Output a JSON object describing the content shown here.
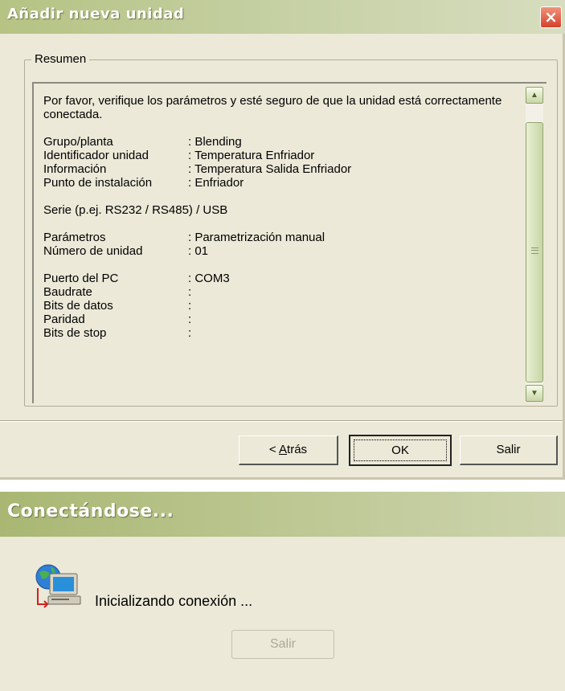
{
  "dialog1": {
    "title": "Añadir nueva unidad",
    "close_label": "×",
    "group_label": "Resumen",
    "intro": "Por favor, verifique los parámetros y esté seguro de que la unidad está correctamente conectada.",
    "rows_a": [
      {
        "key": "Grupo/planta",
        "value": ": Blending"
      },
      {
        "key": "Identificador unidad",
        "value": ": Temperatura Enfriador"
      },
      {
        "key": "Información",
        "value": ": Temperatura Salida Enfriador"
      },
      {
        "key": "Punto de instalación",
        "value": ": Enfriador"
      }
    ],
    "serial_line": "Serie (p.ej. RS232 / RS485) / USB",
    "rows_b": [
      {
        "key": "Parámetros",
        "value": ": Parametrización manual"
      },
      {
        "key": "Número de unidad",
        "value": ": 01"
      }
    ],
    "rows_c": [
      {
        "key": "Puerto del PC",
        "value": ": COM3"
      },
      {
        "key": "Baudrate",
        "value": ":"
      },
      {
        "key": "Bits de datos",
        "value": ":"
      },
      {
        "key": "Paridad",
        "value": ":"
      },
      {
        "key": "Bits de stop",
        "value": ":"
      }
    ],
    "buttons": {
      "back_prefix": "< ",
      "back_mnemonic": "A",
      "back_rest": "trás",
      "ok": "OK",
      "exit": "Salir"
    },
    "scroll_up_icon": "arrow-up-icon",
    "scroll_down_icon": "arrow-down-icon"
  },
  "dialog2": {
    "title": "Conectándose...",
    "message": "Inicializando conexión ...",
    "exit": "Salir",
    "icon": "network-computer-icon"
  },
  "colors": {
    "face": "#ECE9D8",
    "titlebar_olive": "#B5C383",
    "close_red": "#D5412A",
    "disabled_text": "#ACA899"
  }
}
